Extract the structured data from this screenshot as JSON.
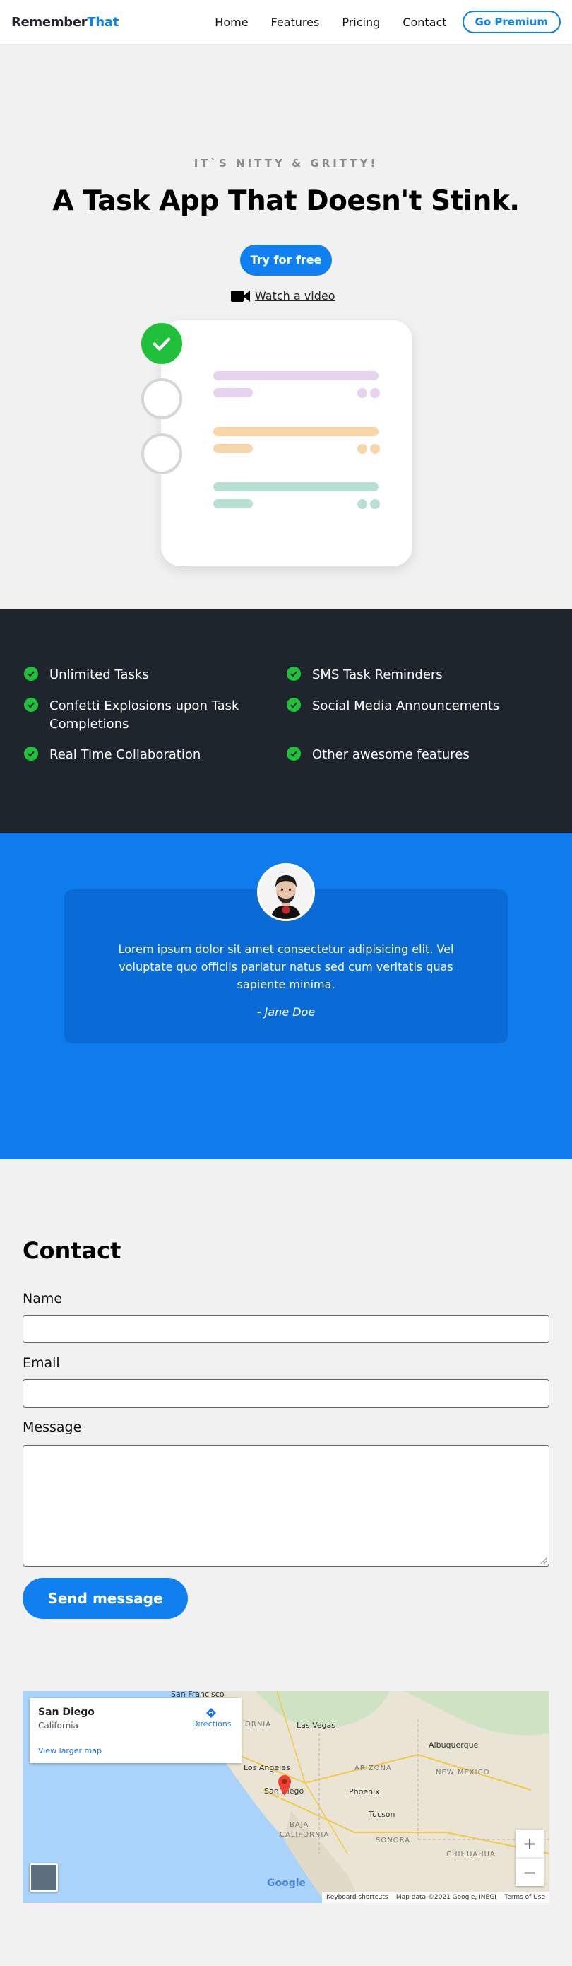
{
  "header": {
    "logo_bold": "Remember",
    "logo_accent": "That",
    "nav": [
      "Home",
      "Features",
      "Pricing",
      "Contact"
    ],
    "premium_label": "Go Premium"
  },
  "hero": {
    "kicker": "IT`S NITTY & GRITTY!",
    "title": "A Task App That Doesn't Stink.",
    "cta_label": "Try for free",
    "video_label": "Watch a video",
    "colors": {
      "purple": "#e6d3f0",
      "orange": "#f9d6a8",
      "green": "#b7e0d0",
      "check": "#20c03a"
    }
  },
  "features": {
    "left": [
      "Unlimited Tasks",
      "Confetti Explosions upon Task Completions",
      "Real Time Collaboration"
    ],
    "right": [
      "SMS Task Reminders",
      "Social Media Announcements",
      "Other awesome features"
    ]
  },
  "testimonial": {
    "quote": "Lorem ipsum dolor sit amet consectetur adipisicing elit. Vel voluptate quo officiis pariatur natus sed cum veritatis quas sapiente minima.",
    "author": "- Jane Doe"
  },
  "contact": {
    "title": "Contact",
    "name_label": "Name",
    "email_label": "Email",
    "message_label": "Message",
    "send_label": "Send message"
  },
  "map": {
    "city": "San Diego",
    "state": "California",
    "larger_link": "View larger map",
    "directions": "Directions",
    "labels": [
      "San Francisco",
      "ORNIA",
      "Las Vegas",
      "Albuquerque",
      "Los Angeles",
      "ARIZONA",
      "NEW MEXICO",
      "San Diego",
      "Phoenix",
      "Tucson",
      "BAJA",
      "CALIFORNIA",
      "SONORA",
      "CHIHUAHUA"
    ],
    "google": "Google",
    "shortcuts": "Keyboard shortcuts",
    "map_data": "Map data ©2021 Google, INEGI",
    "terms": "Terms of Use",
    "zoom_in": "+",
    "zoom_out": "−"
  }
}
